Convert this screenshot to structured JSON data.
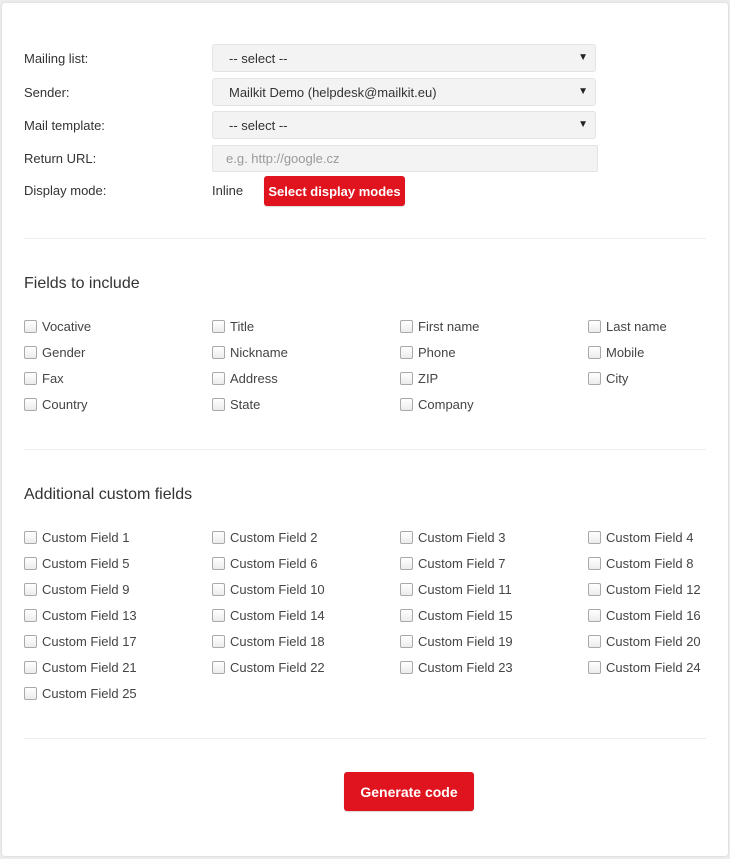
{
  "form": {
    "mailing_list": {
      "label": "Mailing list:",
      "value": "-- select --"
    },
    "sender": {
      "label": "Sender:",
      "value": "Mailkit Demo (helpdesk@mailkit.eu)"
    },
    "mail_template": {
      "label": "Mail template:",
      "value": "-- select --"
    },
    "return_url": {
      "label": "Return URL:",
      "placeholder": "e.g. http://google.cz"
    },
    "display_mode": {
      "label": "Display mode:",
      "value": "Inline",
      "button": "Select display modes"
    }
  },
  "fields_section": {
    "title": "Fields to include",
    "fields": [
      "Vocative",
      "Title",
      "First name",
      "Last name",
      "Gender",
      "Nickname",
      "Phone",
      "Mobile",
      "Fax",
      "Address",
      "ZIP",
      "City",
      "Country",
      "State",
      "Company"
    ]
  },
  "custom_section": {
    "title": "Additional custom fields",
    "fields": [
      "Custom Field 1",
      "Custom Field 2",
      "Custom Field 3",
      "Custom Field 4",
      "Custom Field 5",
      "Custom Field 6",
      "Custom Field 7",
      "Custom Field 8",
      "Custom Field 9",
      "Custom Field 10",
      "Custom Field 11",
      "Custom Field 12",
      "Custom Field 13",
      "Custom Field 14",
      "Custom Field 15",
      "Custom Field 16",
      "Custom Field 17",
      "Custom Field 18",
      "Custom Field 19",
      "Custom Field 20",
      "Custom Field 21",
      "Custom Field 22",
      "Custom Field 23",
      "Custom Field 24",
      "Custom Field 25"
    ]
  },
  "generate_button": "Generate code",
  "colors": {
    "accent": "#e0141e",
    "field_bg": "#f3f3f3"
  },
  "icons": {
    "dropdown": "caret-down-icon",
    "checkbox": "checkbox-unchecked"
  }
}
